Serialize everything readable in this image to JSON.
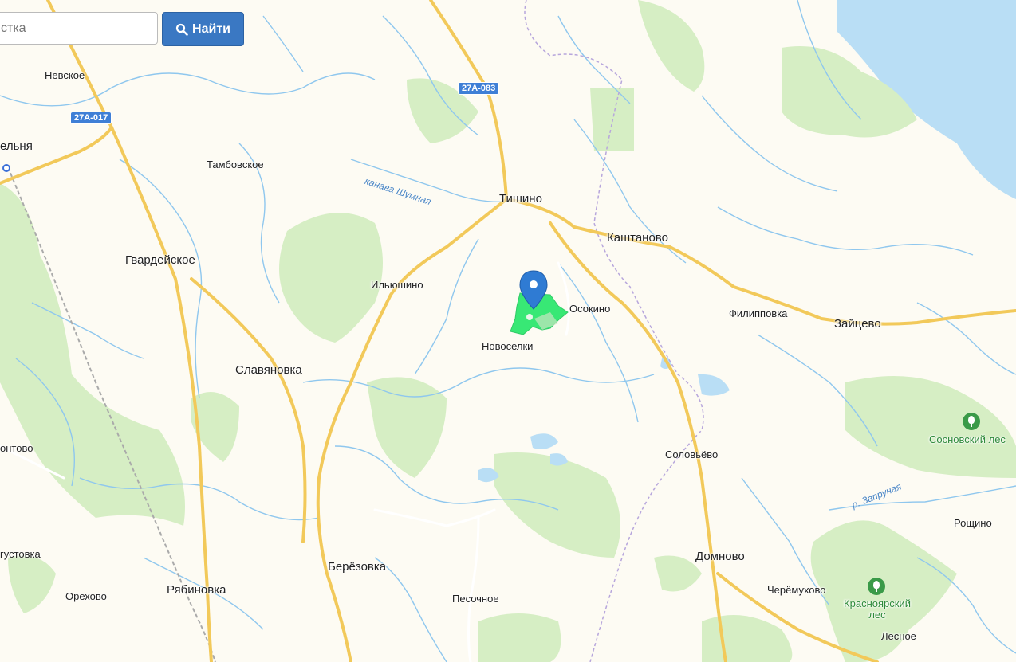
{
  "search": {
    "placeholder": "стка",
    "button_label": "Найти",
    "button_icon": "search-icon"
  },
  "roads": [
    {
      "id": "27A-017",
      "label": "27A-017"
    },
    {
      "id": "27A-083",
      "label": "27A-083"
    }
  ],
  "places": [
    {
      "id": "nevskoe",
      "label": "Невское"
    },
    {
      "id": "tambovskoe",
      "label": "Тамбовское"
    },
    {
      "id": "gvardeyskoe",
      "label": "Гвардейское"
    },
    {
      "id": "ilyushino",
      "label": "Ильюшино"
    },
    {
      "id": "slavyanovka",
      "label": "Славяновка"
    },
    {
      "id": "tishino",
      "label": "Тишино"
    },
    {
      "id": "kashtanovo",
      "label": "Каштаново"
    },
    {
      "id": "osokino",
      "label": "Осокино"
    },
    {
      "id": "novoselki",
      "label": "Новоселки"
    },
    {
      "id": "filippovka",
      "label": "Филипповка"
    },
    {
      "id": "zaytsevo",
      "label": "Зайцево"
    },
    {
      "id": "solovevo",
      "label": "Соловьёво"
    },
    {
      "id": "domnovo",
      "label": "Домново"
    },
    {
      "id": "beryozovka",
      "label": "Берёзовка"
    },
    {
      "id": "pesochnoe",
      "label": "Песочное"
    },
    {
      "id": "ryabinovka",
      "label": "Рябиновка"
    },
    {
      "id": "orekhovo",
      "label": "Орехово"
    },
    {
      "id": "cheryomukhovo",
      "label": "Черёмухово"
    },
    {
      "id": "roshchino",
      "label": "Рощино"
    },
    {
      "id": "lesnoe",
      "label": "Лесное"
    },
    {
      "id": "edge-elnya",
      "label": "ельня"
    },
    {
      "id": "edge-ontovo",
      "label": "онтово"
    },
    {
      "id": "edge-gustovka",
      "label": "густовка"
    }
  ],
  "forests": [
    {
      "id": "sosnovsky",
      "label": "Сосновский лес"
    },
    {
      "id": "krasnoyarsky",
      "label": "Красноярский лес"
    }
  ],
  "water": [
    {
      "id": "kanava-shumnaya",
      "label": "канава Шумная"
    },
    {
      "id": "r-zapruanaya",
      "label": "р. Запруная"
    }
  ],
  "colors": {
    "land": "#fdfbf3",
    "forest": "#d6eec4",
    "water": "#b9def5",
    "stream": "#8fc7ee",
    "road_major": "#f7d87a",
    "road_minor": "#ffffff",
    "marker": "#2f7bd3",
    "plot": "#2ee86f"
  }
}
